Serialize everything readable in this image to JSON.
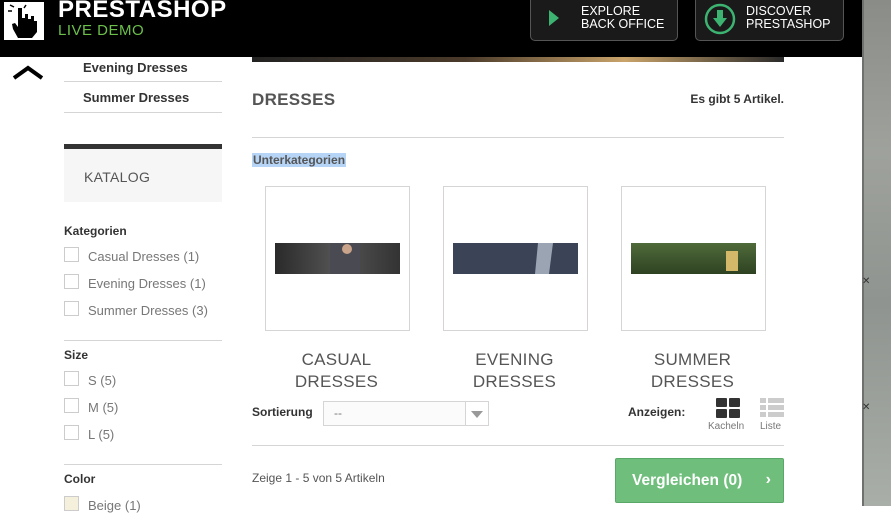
{
  "header": {
    "brand": "PRESTASHOP",
    "brand_sub": "LIVE DEMO",
    "explore_btn": [
      "EXPLORE",
      "BACK OFFICE"
    ],
    "discover_btn": [
      "DISCOVER",
      "PRESTASHOP"
    ]
  },
  "sidebar": {
    "subcategories": [
      "Evening Dresses",
      "Summer Dresses"
    ],
    "katalog_title": "KATALOG",
    "filters": [
      {
        "title": "Kategorien",
        "options": [
          "Casual Dresses (1)",
          "Evening Dresses (1)",
          "Summer Dresses (3)"
        ]
      },
      {
        "title": "Size",
        "options": [
          "S (5)",
          "M (5)",
          "L (5)"
        ]
      },
      {
        "title": "Color",
        "options": [
          "Beige (1)"
        ]
      }
    ],
    "color_swatch": "#f5f0dc"
  },
  "main": {
    "title": "DRESSES",
    "count": "Es gibt 5 Artikel.",
    "subcategories_heading": "Unterkategorien",
    "categories": [
      {
        "line1": "CASUAL",
        "line2": "DRESSES"
      },
      {
        "line1": "EVENING",
        "line2": "DRESSES"
      },
      {
        "line1": "SUMMER",
        "line2": "DRESSES"
      }
    ],
    "sort_label": "Sortierung",
    "sort_value": "--",
    "view_label": "Anzeigen:",
    "view_grid": "Kacheln",
    "view_list": "Liste",
    "showing": "Zeige 1 - 5 von 5 Artikeln",
    "compare_button": "Vergleichen (0)"
  },
  "colors": {
    "topbar": "#000000",
    "accent_green": "#6cc04a",
    "compare_green": "#6fbe7c"
  },
  "icons": [
    "hand-logo-icon",
    "play-arrow-icon",
    "download-arrow-icon",
    "chevron-up-icon",
    "grid-view-icon",
    "list-view-icon",
    "chevron-right-icon",
    "dropdown-arrow-icon"
  ]
}
